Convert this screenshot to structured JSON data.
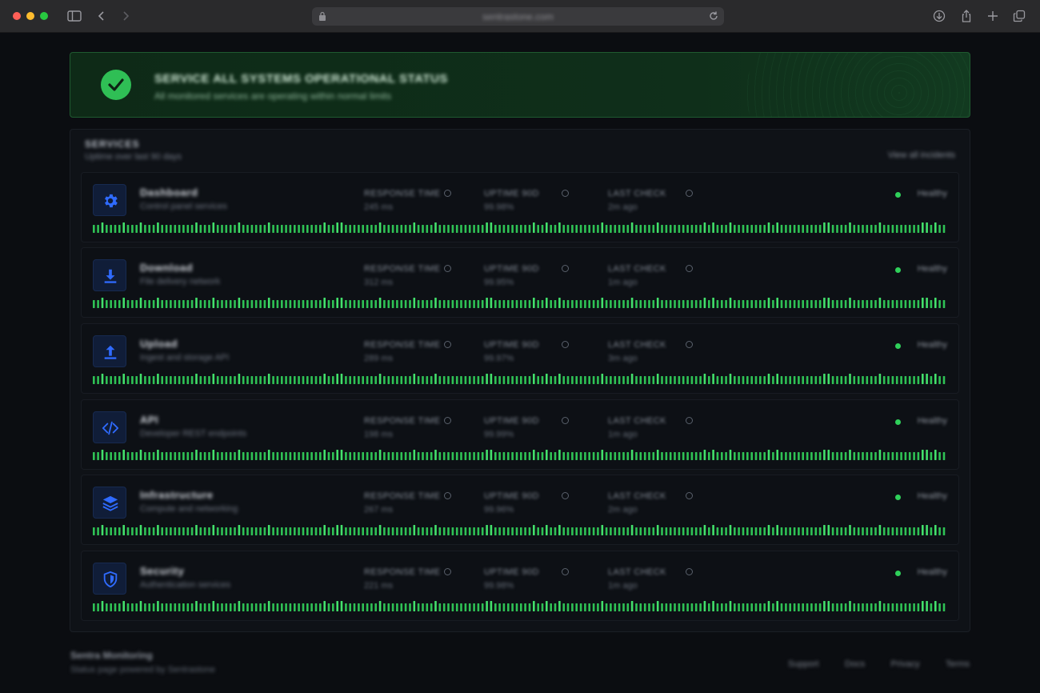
{
  "browser": {
    "url": "sentrastone.com"
  },
  "banner": {
    "title": "SERVICE ALL SYSTEMS OPERATIONAL STATUS",
    "subtitle": "All monitored services are operating within normal limits"
  },
  "panel": {
    "title": "SERVICES",
    "subtitle": "Uptime over last 90 days",
    "link": "View all incidents"
  },
  "services": [
    {
      "name": "Dashboard",
      "desc": "Control panel services",
      "icon": "gear-icon",
      "metrics": [
        {
          "label": "RESPONSE TIME",
          "value": "245 ms"
        },
        {
          "label": "UPTIME 90D",
          "value": "99.98%"
        },
        {
          "label": "LAST CHECK",
          "value": "2m ago"
        }
      ],
      "status": "Healthy"
    },
    {
      "name": "Download",
      "desc": "File delivery network",
      "icon": "download-icon",
      "metrics": [
        {
          "label": "RESPONSE TIME",
          "value": "312 ms"
        },
        {
          "label": "UPTIME 90D",
          "value": "99.95%"
        },
        {
          "label": "LAST CHECK",
          "value": "1m ago"
        }
      ],
      "status": "Healthy"
    },
    {
      "name": "Upload",
      "desc": "Ingest and storage API",
      "icon": "upload-icon",
      "metrics": [
        {
          "label": "RESPONSE TIME",
          "value": "289 ms"
        },
        {
          "label": "UPTIME 90D",
          "value": "99.97%"
        },
        {
          "label": "LAST CHECK",
          "value": "3m ago"
        }
      ],
      "status": "Healthy"
    },
    {
      "name": "API",
      "desc": "Developer REST endpoints",
      "icon": "code-icon",
      "metrics": [
        {
          "label": "RESPONSE TIME",
          "value": "198 ms"
        },
        {
          "label": "UPTIME 90D",
          "value": "99.99%"
        },
        {
          "label": "LAST CHECK",
          "value": "1m ago"
        }
      ],
      "status": "Healthy"
    },
    {
      "name": "Infrastructure",
      "desc": "Compute and networking",
      "icon": "layers-icon",
      "metrics": [
        {
          "label": "RESPONSE TIME",
          "value": "267 ms"
        },
        {
          "label": "UPTIME 90D",
          "value": "99.96%"
        },
        {
          "label": "LAST CHECK",
          "value": "2m ago"
        }
      ],
      "status": "Healthy"
    },
    {
      "name": "Security",
      "desc": "Authentication services",
      "icon": "shield-icon",
      "metrics": [
        {
          "label": "RESPONSE TIME",
          "value": "221 ms"
        },
        {
          "label": "UPTIME 90D",
          "value": "99.98%"
        },
        {
          "label": "LAST CHECK",
          "value": "1m ago"
        }
      ],
      "status": "Healthy"
    }
  ],
  "colors": {
    "accent_blue": "#2f6bff",
    "ok_green": "#2fd05a",
    "banner_bg": "#0f2f1a"
  },
  "footer": {
    "brand": "Sentra Monitoring",
    "copy": "Status page powered by Sentrastone",
    "links": [
      "Support",
      "Docs",
      "Privacy",
      "Terms"
    ]
  }
}
